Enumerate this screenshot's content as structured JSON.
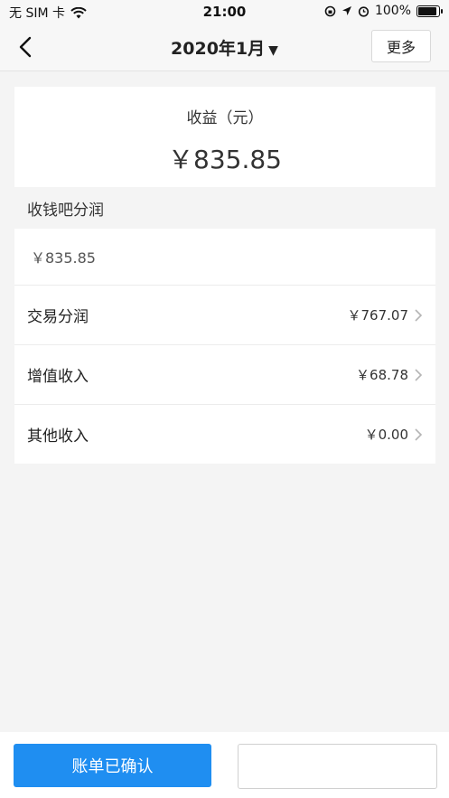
{
  "status": {
    "carrier": "无 SIM 卡",
    "time": "21:00",
    "battery": "100%",
    "battery_level": 1.0
  },
  "nav": {
    "title": "2020年1月",
    "more_label": "更多"
  },
  "summary": {
    "label": "收益（元）",
    "amount": "￥835.85"
  },
  "section": {
    "title": "收钱吧分润",
    "subtotal": "￥835.85",
    "rows": [
      {
        "label": "交易分润",
        "value": "￥767.07"
      },
      {
        "label": "增值收入",
        "value": "￥68.78"
      },
      {
        "label": "其他收入",
        "value": "￥0.00"
      }
    ]
  },
  "footer": {
    "confirm_label": "账单已确认"
  }
}
